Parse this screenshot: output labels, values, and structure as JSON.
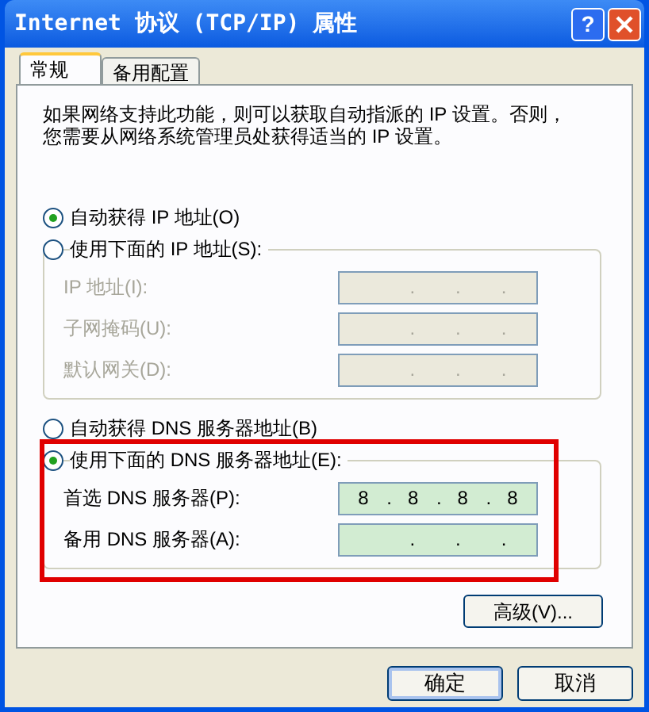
{
  "window": {
    "title": "Internet 协议 (TCP/IP) 属性",
    "help": "?"
  },
  "tabs": [
    {
      "label": "常规",
      "selected": true
    },
    {
      "label": "备用配置",
      "selected": false
    }
  ],
  "intro_lines": [
    "如果网络支持此功能，则可以获取自动指派的 IP 设置。否则，",
    "您需要从网络系统管理员处获得适当的 IP 设置。"
  ],
  "octet_separator": ".",
  "sections": [
    {
      "auto_option": {
        "label": "自动获得 IP 地址(O)",
        "selected": true
      },
      "manual_option": {
        "label": "使用下面的 IP 地址(S):",
        "selected": false
      },
      "fields": [
        {
          "label": "IP 地址(I):",
          "disabled": true
        },
        {
          "label": "子网掩码(U):",
          "disabled": true
        },
        {
          "label": "默认网关(D):",
          "disabled": true
        }
      ],
      "highlighted": false
    },
    {
      "auto_option": {
        "label": "自动获得 DNS 服务器地址(B)",
        "selected": false
      },
      "manual_option": {
        "label": "使用下面的 DNS 服务器地址(E):",
        "selected": true
      },
      "fields": [
        {
          "label": "首选 DNS 服务器(P):",
          "octets": [
            "8",
            "8",
            "8",
            "8"
          ],
          "disabled": false
        },
        {
          "label": "备用 DNS 服务器(A):",
          "disabled": false
        }
      ],
      "highlighted": true
    }
  ],
  "advanced_button": "高级(V)...",
  "buttons": [
    {
      "label": "确定",
      "default": true
    },
    {
      "label": "取消",
      "default": false
    }
  ]
}
